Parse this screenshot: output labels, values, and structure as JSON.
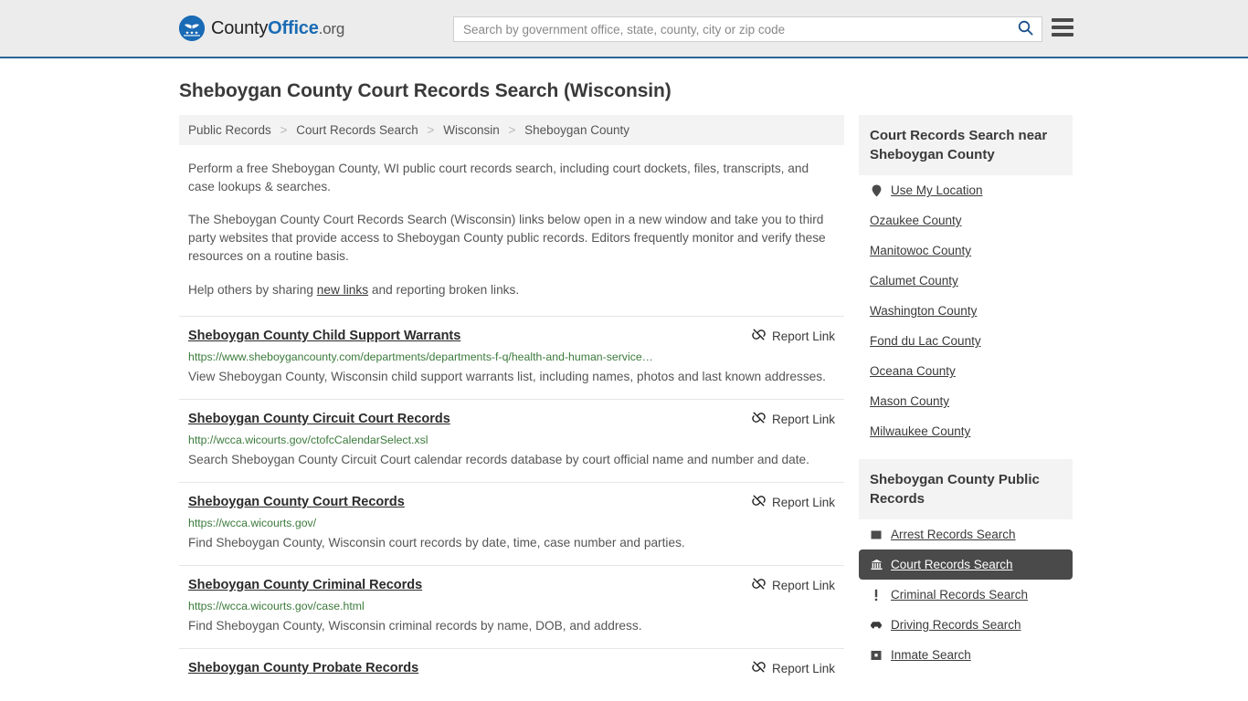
{
  "header": {
    "brand": {
      "part1": "County",
      "part2": "Office",
      "tld": ".org"
    },
    "search": {
      "placeholder": "Search by government office, state, county, city or zip code",
      "value": ""
    }
  },
  "page": {
    "title": "Sheboygan County Court Records Search (Wisconsin)"
  },
  "breadcrumb": {
    "items": [
      {
        "label": "Public Records"
      },
      {
        "label": "Court Records Search"
      },
      {
        "label": "Wisconsin"
      },
      {
        "label": "Sheboygan County"
      }
    ],
    "separator": ">"
  },
  "intro": {
    "p1": "Perform a free Sheboygan County, WI public court records search, including court dockets, files, transcripts, and case lookups & searches.",
    "p2": "The Sheboygan County Court Records Search (Wisconsin) links below open in a new window and take you to third party websites that provide access to Sheboygan County public records. Editors frequently monitor and verify these resources on a routine basis.",
    "p3_before": "Help others by sharing ",
    "p3_link": "new links",
    "p3_after": " and reporting broken links."
  },
  "results": {
    "report_label": "Report Link",
    "items": [
      {
        "title": "Sheboygan County Child Support Warrants",
        "url": "https://www.sheboygancounty.com/departments/departments-f-q/health-and-human-service…",
        "desc": "View Sheboygan County, Wisconsin child support warrants list, including names, photos and last known addresses."
      },
      {
        "title": "Sheboygan County Circuit Court Records",
        "url": "http://wcca.wicourts.gov/ctofcCalendarSelect.xsl",
        "desc": "Search Sheboygan County Circuit Court calendar records database by court official name and number and date."
      },
      {
        "title": "Sheboygan County Court Records",
        "url": "https://wcca.wicourts.gov/",
        "desc": "Find Sheboygan County, Wisconsin court records by date, time, case number and parties."
      },
      {
        "title": "Sheboygan County Criminal Records",
        "url": "https://wcca.wicourts.gov/case.html",
        "desc": "Find Sheboygan County, Wisconsin criminal records by name, DOB, and address."
      },
      {
        "title": "Sheboygan County Probate Records",
        "url": "",
        "desc": ""
      }
    ]
  },
  "sidebar": {
    "nearby": {
      "heading": "Court Records Search near Sheboygan County",
      "items": [
        {
          "label": "Use My Location",
          "icon": "map-pin-icon"
        },
        {
          "label": "Ozaukee County",
          "icon": ""
        },
        {
          "label": "Manitowoc County",
          "icon": ""
        },
        {
          "label": "Calumet County",
          "icon": ""
        },
        {
          "label": "Washington County",
          "icon": ""
        },
        {
          "label": "Fond du Lac County",
          "icon": ""
        },
        {
          "label": "Oceana County",
          "icon": ""
        },
        {
          "label": "Mason County",
          "icon": ""
        },
        {
          "label": "Milwaukee County",
          "icon": ""
        }
      ]
    },
    "public_records": {
      "heading": "Sheboygan County Public Records",
      "items": [
        {
          "label": "Arrest Records Search",
          "icon": "square-icon",
          "active": false
        },
        {
          "label": "Court Records Search",
          "icon": "bank-icon",
          "active": true
        },
        {
          "label": "Criminal Records Search",
          "icon": "exclamation-icon",
          "active": false
        },
        {
          "label": "Driving Records Search",
          "icon": "car-icon",
          "active": false
        },
        {
          "label": "Inmate Search",
          "icon": "jail-icon",
          "active": false
        }
      ]
    }
  },
  "colors": {
    "brand_blue": "#1a6bb5",
    "header_bg": "#ececec",
    "header_border": "#2a6496",
    "panel_bg": "#f3f3f3",
    "active_bg": "#4a4a4a",
    "url_green": "#3b7a3b"
  }
}
